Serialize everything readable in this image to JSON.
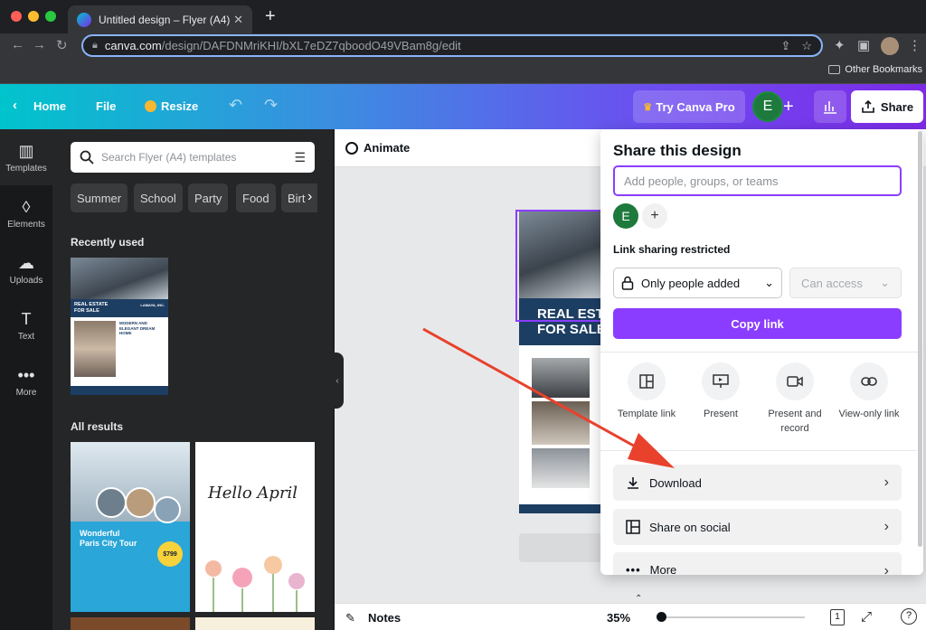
{
  "browser": {
    "tab_title": "Untitled design – Flyer (A4)",
    "url_host": "canva.com",
    "url_path": "/design/DAFDNMriKHI/bXL7eDZ7qboodO49VBam8g/edit",
    "bookmarks_label": "Other Bookmarks"
  },
  "header": {
    "home_label": "Home",
    "file_label": "File",
    "resize_label": "Resize",
    "try_pro_label": "Try Canva Pro",
    "avatar_letter": "E",
    "share_label": "Share"
  },
  "rail": {
    "items": [
      {
        "label": "Templates",
        "icon": "templates-icon"
      },
      {
        "label": "Elements",
        "icon": "elements-icon"
      },
      {
        "label": "Uploads",
        "icon": "uploads-icon"
      },
      {
        "label": "Text",
        "icon": "text-icon"
      },
      {
        "label": "More",
        "icon": "more-icon"
      }
    ]
  },
  "panel": {
    "search_placeholder": "Search Flyer (A4) templates",
    "chips": [
      "Summer",
      "School",
      "Party",
      "Food",
      "Birt"
    ],
    "recently_used": "Recently used",
    "all_results": "All results",
    "thumb1": {
      "line1": "REAL ESTATE",
      "line2": "FOR SALE",
      "line3": "MODERN AND",
      "line4": "ELEGANT DREAM",
      "line5": "HOME",
      "brand": "LAMAYA, INC."
    },
    "thumb2": {
      "line1": "Wonderful",
      "line2": "Paris City Tour",
      "price": "$799"
    },
    "thumb3": {
      "text": "Hello April"
    }
  },
  "editor": {
    "animate_label": "Animate",
    "flyer_text1": "REAL ESTA",
    "flyer_text2": "FOR SALE",
    "notes_label": "Notes",
    "zoom": "35%",
    "page_count": "1"
  },
  "share_panel": {
    "title": "Share this design",
    "input_placeholder": "Add people, groups, or teams",
    "avatar_letter": "E",
    "link_sharing_label": "Link sharing restricted",
    "access_scope": "Only people added",
    "access_level": "Can access",
    "copy_link_label": "Copy link",
    "options": [
      {
        "label": "Template link",
        "icon": "template-link-icon"
      },
      {
        "label": "Present",
        "icon": "present-icon"
      },
      {
        "label": "Present and record",
        "icon": "record-icon"
      },
      {
        "label": "View-only link",
        "icon": "link-icon"
      }
    ],
    "rows": [
      {
        "label": "Download",
        "icon": "download-icon"
      },
      {
        "label": "Share on social",
        "icon": "social-icon"
      },
      {
        "label": "More",
        "icon": "more-dots-icon"
      }
    ]
  },
  "colors": {
    "accent_purple": "#8b3dff",
    "annotation_arrow": "#e8412c",
    "avatar_green": "#1d7a3c"
  }
}
